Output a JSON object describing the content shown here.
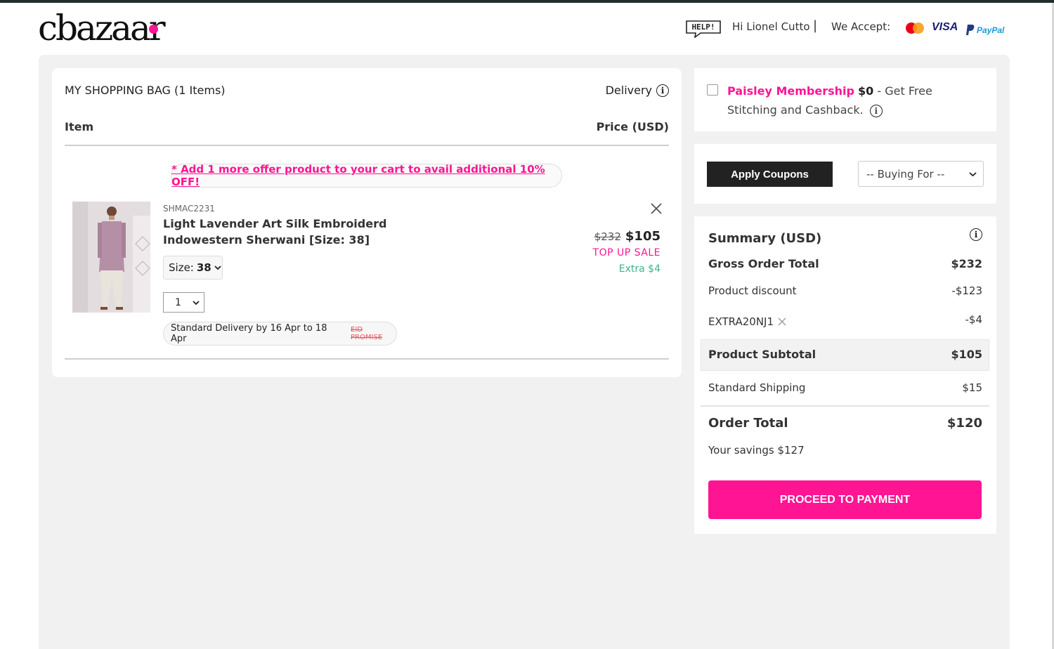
{
  "header": {
    "logo": "cbazaar",
    "help_label": "HELP!",
    "greeting": "Hi Lionel Cutto",
    "separator": "|",
    "we_accept": "We Accept:",
    "visa": "VISA",
    "paypal": "PayPal"
  },
  "bag": {
    "title": "MY SHOPPING BAG (1 Items)",
    "delivery_label": "Delivery",
    "col_item": "Item",
    "col_price": "Price (USD)",
    "offer_text": "* Add 1 more offer product to your cart to avail additional 10% OFF!",
    "product": {
      "sku": "SHMAC2231",
      "name": "Light Lavender Art Silk Embroiderd Indowestern Sherwani [Size: 38]",
      "size_label": "Size:",
      "size_value": "38",
      "qty": "1",
      "delivery_text": "Standard Delivery by 16 Apr to 18 Apr",
      "promise_tag": "EID PROMISE",
      "old_price": "$232",
      "new_price": "$105",
      "sale_label": "TOP UP SALE",
      "extra_label": "Extra $4"
    }
  },
  "membership": {
    "name": "Paisley Membership",
    "price": "$0",
    "text": " - Get Free Stitching and Cashback."
  },
  "coupon": {
    "apply_label": "Apply Coupons",
    "buying_for": "-- Buying For --"
  },
  "summary": {
    "title": "Summary (USD)",
    "gross_label": "Gross Order Total",
    "gross_value": "$232",
    "discount_label": "Product discount",
    "discount_value": "-$123",
    "coupon_code": "EXTRA20NJ1",
    "coupon_value": "-$4",
    "subtotal_label": "Product Subtotal",
    "subtotal_value": "$105",
    "shipping_label": "Standard Shipping",
    "shipping_value": "$15",
    "order_total_label": "Order Total",
    "order_total_value": "$120",
    "savings": "Your savings $127",
    "pay_label": "PROCEED TO PAYMENT"
  },
  "colors": {
    "accent": "#ff1493",
    "dark_button": "#222222",
    "extra_green": "#3cb38c"
  }
}
